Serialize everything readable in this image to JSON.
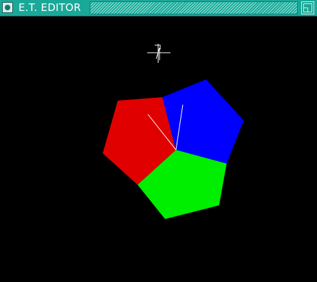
{
  "window": {
    "title": "E.T. EDITOR"
  },
  "titlebar": {
    "close_icon": "close-box-icon",
    "zoom_icon": "zoom-box-icon",
    "color": "#1aa898"
  },
  "canvas": {
    "background": "#000000",
    "cursor_icon": "crosshair-cursor-icon",
    "shapes": [
      {
        "name": "red-pentagon",
        "color": "#e00000"
      },
      {
        "name": "blue-pentagon",
        "color": "#0000ff"
      },
      {
        "name": "green-pentagon",
        "color": "#00ee00"
      }
    ]
  }
}
